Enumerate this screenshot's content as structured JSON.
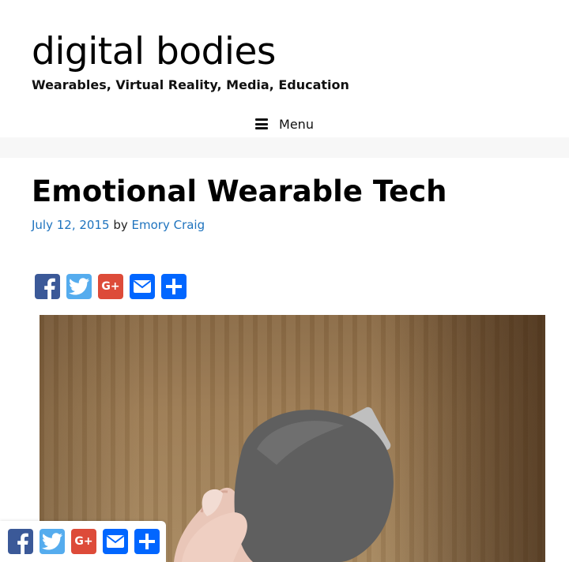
{
  "site": {
    "title": "digital bodies",
    "tagline": "Wearables, Virtual Reality, Media, Education"
  },
  "nav": {
    "menu_label": "Menu"
  },
  "post": {
    "title": "Emotional Wearable Tech",
    "date": "July 12, 2015",
    "by": "by",
    "author": "Emory Craig"
  },
  "share": {
    "buttons": [
      {
        "service": "facebook",
        "icon": "facebook-icon",
        "color": "#3b5998"
      },
      {
        "service": "twitter",
        "icon": "twitter-icon",
        "color": "#55acee"
      },
      {
        "service": "google-plus",
        "icon": "google-plus-icon",
        "label": "G+",
        "color": "#dd4b39"
      },
      {
        "service": "email",
        "icon": "email-icon",
        "color": "#0166ff"
      },
      {
        "service": "share",
        "icon": "share-plus-icon",
        "color": "#0166ff"
      }
    ]
  },
  "colors": {
    "link": "#1e73be",
    "band": "#f7f7f7"
  }
}
